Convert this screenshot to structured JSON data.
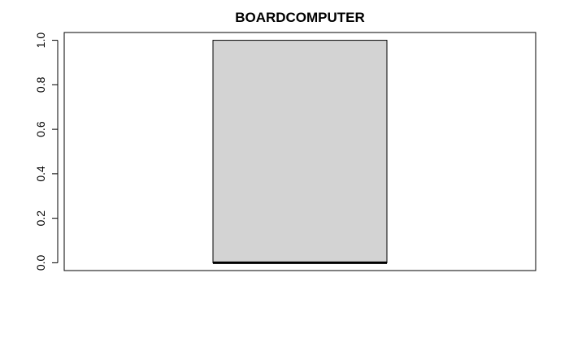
{
  "chart_data": {
    "type": "box",
    "title": "BOARDCOMPUTER",
    "xlabel": "",
    "ylabel": "",
    "ylim": [
      -0.035,
      1.035
    ],
    "y_ticks": [
      0.0,
      0.2,
      0.4,
      0.6,
      0.8,
      1.0
    ],
    "y_tick_labels": [
      "0.0",
      "0.2",
      "0.4",
      "0.6",
      "0.8",
      "1.0"
    ],
    "grid": false,
    "legend": "none",
    "box": {
      "lower_whisker": 0.0,
      "q1": 0.0,
      "median": 0.0,
      "q3": 1.0,
      "upper_whisker": 1.0
    },
    "colors": {
      "box_fill": "#d3d3d3",
      "stroke": "#000000",
      "background": "#ffffff"
    }
  }
}
